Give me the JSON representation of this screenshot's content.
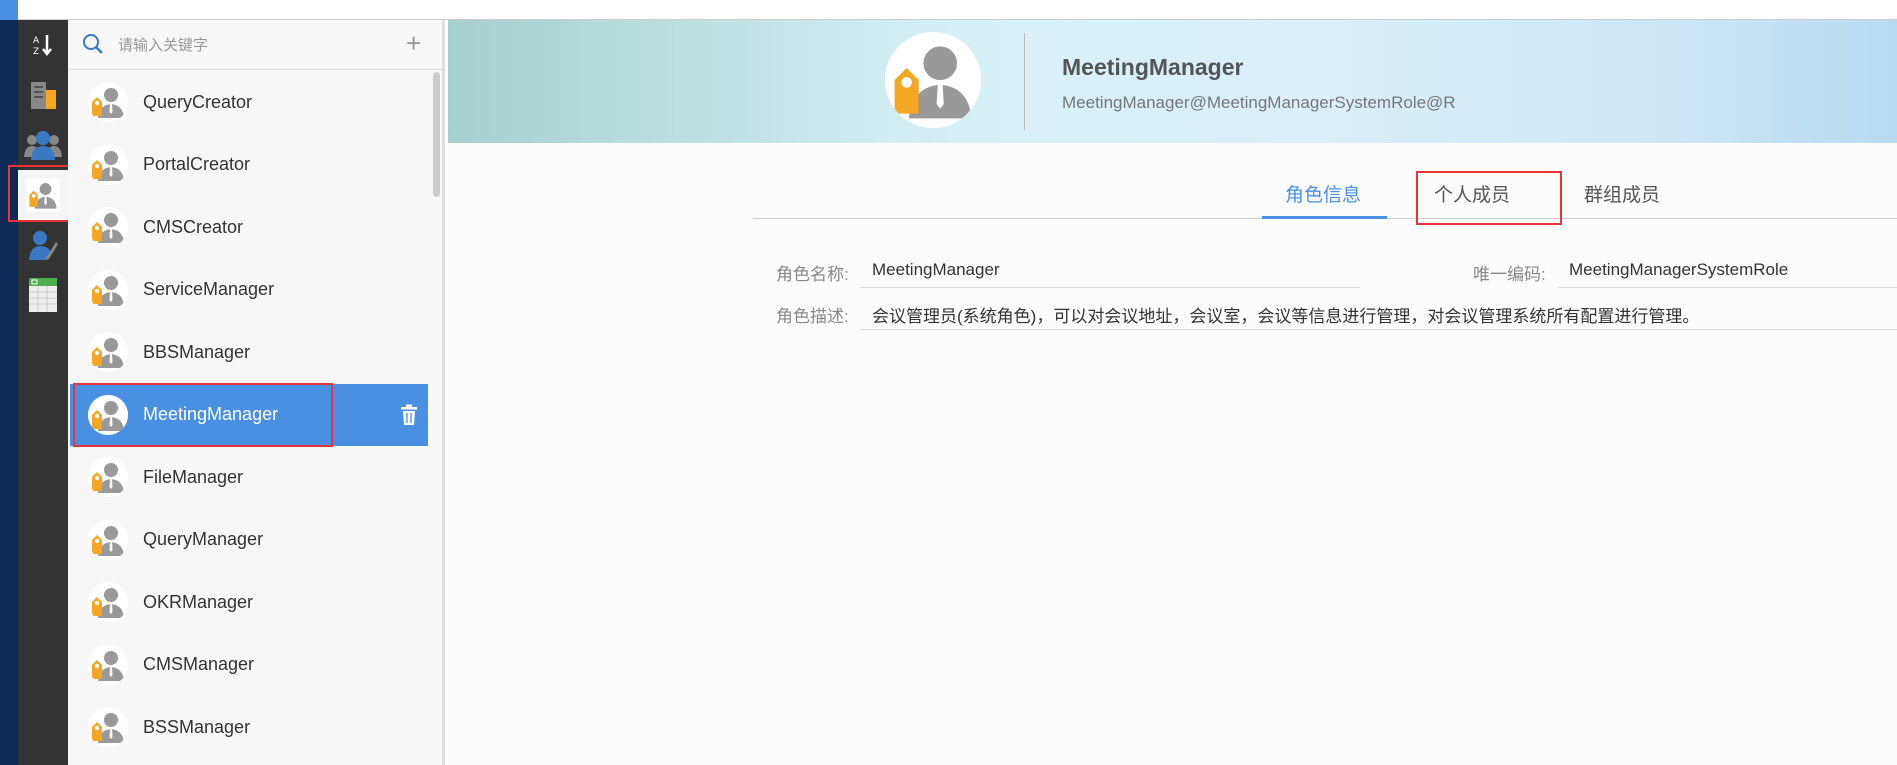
{
  "sidebar_icons": [
    "sort-az-icon",
    "organization-icon",
    "group-icon",
    "role-icon",
    "person-edit-icon",
    "spreadsheet-icon"
  ],
  "search": {
    "placeholder": "请输入关键字",
    "add_label": "+"
  },
  "roles": [
    "QueryCreator",
    "PortalCreator",
    "CMSCreator",
    "ServiceManager",
    "BBSManager",
    "MeetingManager",
    "FileManager",
    "QueryManager",
    "OKRManager",
    "CMSManager",
    "BSSManager"
  ],
  "selected_index": 5,
  "header": {
    "title": "MeetingManager",
    "subtitle": "MeetingManager@MeetingManagerSystemRole@R"
  },
  "tabs": [
    {
      "label": "角色信息",
      "active": true
    },
    {
      "label": "个人成员"
    },
    {
      "label": "群组成员"
    }
  ],
  "form": {
    "name_label": "角色名称:",
    "name_value": "MeetingManager",
    "code_label": "唯一编码:",
    "code_value": "MeetingManagerSystemRole",
    "desc_label": "角色描述:",
    "desc_value": "会议管理员(系统角色)，可以对会议地址，会议室，会议等信息进行管理，对会议管理系统所有配置进行管理。"
  },
  "colors": {
    "accent": "#4a90e2",
    "highlight": "#e8333a"
  }
}
